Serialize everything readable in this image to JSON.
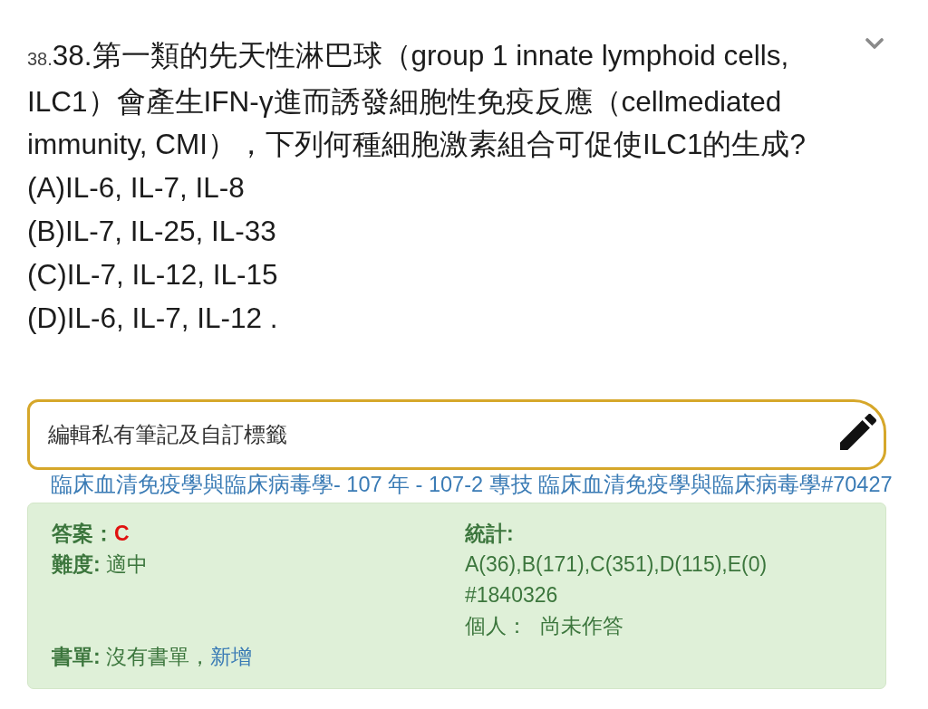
{
  "question": {
    "number_prefix": "38.",
    "text": "38.第一類的先天性淋巴球（group 1 innate lymphoid cells, ILC1）會產生IFN-γ進而誘發細胞性免疫反應（cellmediated immunity, CMI），下列何種細胞激素組合可促使ILC1的生成?",
    "options": [
      "(A)IL-6, IL-7, IL-8",
      "(B)IL-7, IL-25, IL-33",
      "(C)IL-7, IL-12, IL-15",
      "(D)IL-6, IL-7, IL-12 ."
    ]
  },
  "note_button": {
    "label": "編輯私有筆記及自訂標籤"
  },
  "source_link": "臨床血清免疫學與臨床病毒學- 107 年 - 107-2 專技 臨床血清免疫學與臨床病毒學#70427",
  "info": {
    "answer_label": "答案：",
    "answer": "C",
    "difficulty_label": "難度:",
    "difficulty": "適中",
    "stats_label": "統計:",
    "stats": "A(36),B(171),C(351),D(115),E(0)",
    "stats_id": "#1840326",
    "personal_label": "個人：",
    "personal_value": "尚未作答",
    "booklist_label": "書單:",
    "booklist_value": "沒有書單，",
    "booklist_link": "新增"
  }
}
